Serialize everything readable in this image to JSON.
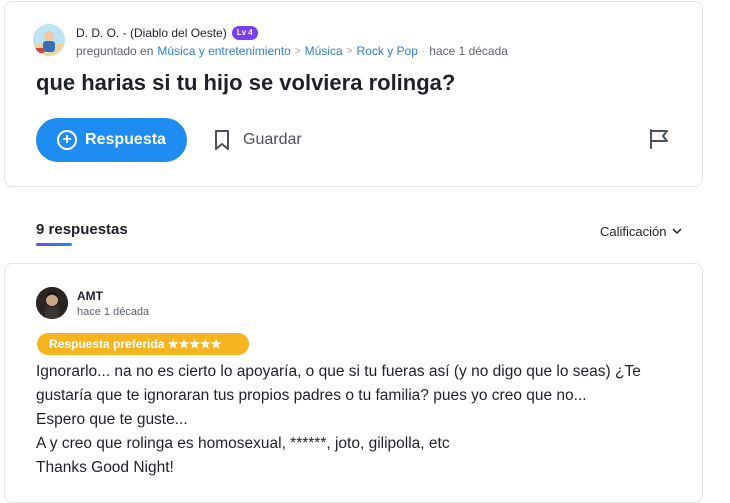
{
  "question": {
    "author": "D. D. O. - (Diablo del Oeste)",
    "level": "Lv 4",
    "asked_label": "preguntado en",
    "categories": [
      "Música y entretenimiento",
      "Música",
      "Rock y Pop"
    ],
    "time": "hace 1 década",
    "title": "que harias si tu hijo se volviera rolinga?",
    "answer_button": "Respuesta",
    "save_button": "Guardar"
  },
  "answers_header": {
    "count_label": "9 respuestas",
    "sort_label": "Calificación"
  },
  "answer": {
    "author": "AMT",
    "time": "hace 1 década",
    "badge": "Respuesta preferida ★★★★★",
    "lines": [
      "Ignorarlo... na no es cierto lo apoyaría, o que si tu fueras así (y no digo que lo seas) ¿Te",
      "gustaría que te ignoraran tus propios padres o tu familia? pues yo creo que no...",
      "Espero que te guste...",
      "A y creo que rolinga es homosexual, ******, joto, gilipolla, etc",
      "Thanks Good Night!"
    ]
  },
  "colors": {
    "accent": "#1e8cf0",
    "level_badge": "#7b3ff2",
    "best_badge": "#f6b51e",
    "link": "#2c7fd8"
  },
  "icons": [
    "plus-circle-icon",
    "bookmark-icon",
    "flag-icon",
    "chevron-down-icon",
    "chevron-right-icon"
  ]
}
